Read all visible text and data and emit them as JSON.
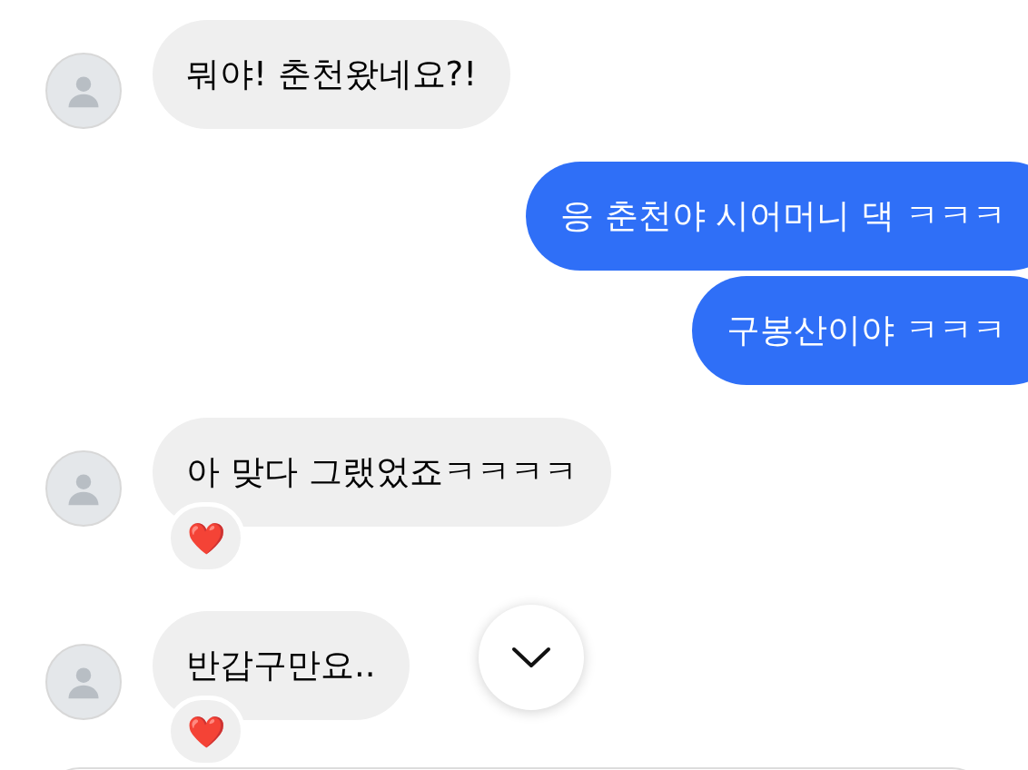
{
  "messages": [
    {
      "kind": "incoming",
      "text": "뭐야! 춘천왔네요?!"
    },
    {
      "kind": "outgoing",
      "text": "응 춘천야 시어머니 댁 ㅋㅋㅋ"
    },
    {
      "kind": "outgoing",
      "text": "구봉산이야 ㅋㅋㅋ"
    },
    {
      "kind": "incoming",
      "text": "아 맞다 그랬었죠ㅋㅋㅋㅋ",
      "reaction": "❤️"
    },
    {
      "kind": "incoming",
      "text": "반갑구만요..",
      "reaction": "❤️"
    }
  ]
}
